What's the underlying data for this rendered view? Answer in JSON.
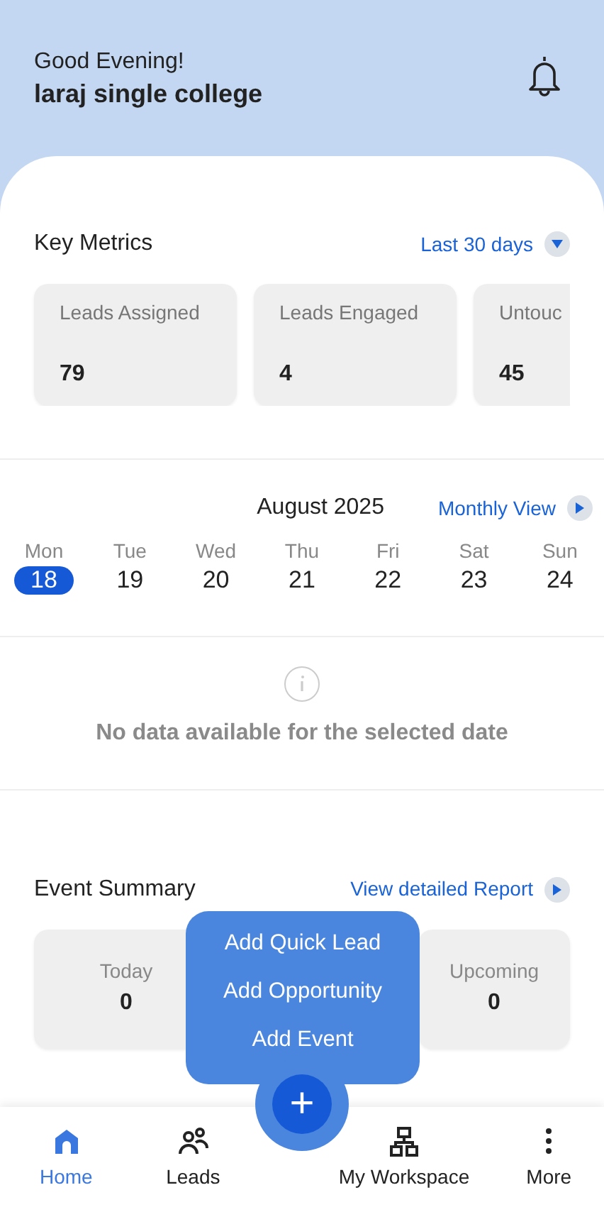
{
  "header": {
    "greeting": "Good Evening!",
    "name": "laraj single college"
  },
  "key_metrics": {
    "title": "Key Metrics",
    "range": "Last 30 days",
    "cards": [
      {
        "label": "Leads Assigned",
        "value": "79"
      },
      {
        "label": "Leads Engaged",
        "value": "4"
      },
      {
        "label": "Untouc",
        "value": "45"
      }
    ]
  },
  "calendar": {
    "month": "August 2025",
    "view_link": "Monthly View",
    "days": [
      {
        "day": "Mon",
        "date": "18",
        "selected": true
      },
      {
        "day": "Tue",
        "date": "19",
        "selected": false
      },
      {
        "day": "Wed",
        "date": "20",
        "selected": false
      },
      {
        "day": "Thu",
        "date": "21",
        "selected": false
      },
      {
        "day": "Fri",
        "date": "22",
        "selected": false
      },
      {
        "day": "Sat",
        "date": "23",
        "selected": false
      },
      {
        "day": "Sun",
        "date": "24",
        "selected": false
      }
    ]
  },
  "empty_state": {
    "message": "No data available for the selected date"
  },
  "event_summary": {
    "title": "Event Summary",
    "report_link": "View detailed Report",
    "cards": [
      {
        "label": "Today",
        "value": "0"
      },
      {
        "label": "Upcoming",
        "value": "0"
      }
    ]
  },
  "quick_menu": {
    "items": [
      "Add Quick Lead",
      "Add Opportunity",
      "Add Event"
    ],
    "fab": "+"
  },
  "bottom_nav": [
    {
      "kind": "home",
      "label": "Home",
      "selected": true
    },
    {
      "kind": "leads",
      "label": "Leads",
      "selected": false
    },
    {
      "kind": "workspace",
      "label": "My Workspace",
      "selected": false
    },
    {
      "kind": "more",
      "label": "More",
      "selected": false
    }
  ]
}
